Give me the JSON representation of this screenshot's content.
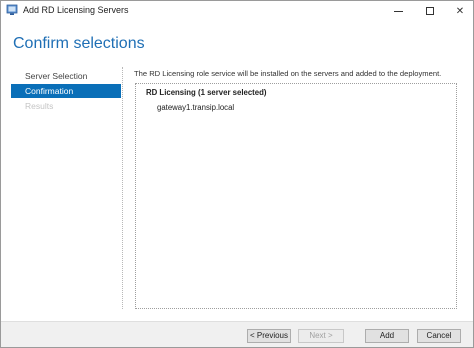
{
  "window": {
    "title": "Add RD Licensing Servers",
    "minimize_glyph": "",
    "close_glyph": "✕"
  },
  "page": {
    "title": "Confirm selections"
  },
  "sidebar": {
    "items": [
      {
        "label": "Server Selection",
        "state": "normal"
      },
      {
        "label": "Confirmation",
        "state": "active"
      },
      {
        "label": "Results",
        "state": "disabled"
      }
    ]
  },
  "content": {
    "description": "The RD Licensing role service will be installed on the servers and added to the deployment.",
    "role_header": "RD Licensing  (1 server selected)",
    "servers": [
      "gateway1.transip.local"
    ]
  },
  "buttons": {
    "previous": "< Previous",
    "next": "Next >",
    "add": "Add",
    "cancel": "Cancel"
  },
  "colors": {
    "accent": "#0a6fb8",
    "title": "#1f6fb5"
  },
  "icons": {
    "app": "server-manager-icon"
  }
}
